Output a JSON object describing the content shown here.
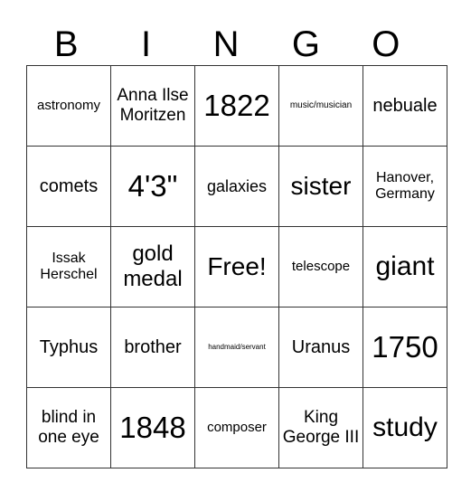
{
  "header": [
    "B",
    "I",
    "N",
    "G",
    "O"
  ],
  "cells": [
    [
      "astronomy",
      "Anna Ilse Moritzen",
      "1822",
      "music/musician",
      "nebuale"
    ],
    [
      "comets",
      "4'3\"",
      "galaxies",
      "sister",
      "Hanover, Germany"
    ],
    [
      "Issak Herschel",
      "gold medal",
      "Free!",
      "telescope",
      "giant"
    ],
    [
      "Typhus",
      "brother",
      "handmaid/servant",
      "Uranus",
      "1750"
    ],
    [
      "blind in one eye",
      "1848",
      "composer",
      "King George III",
      "study"
    ]
  ]
}
